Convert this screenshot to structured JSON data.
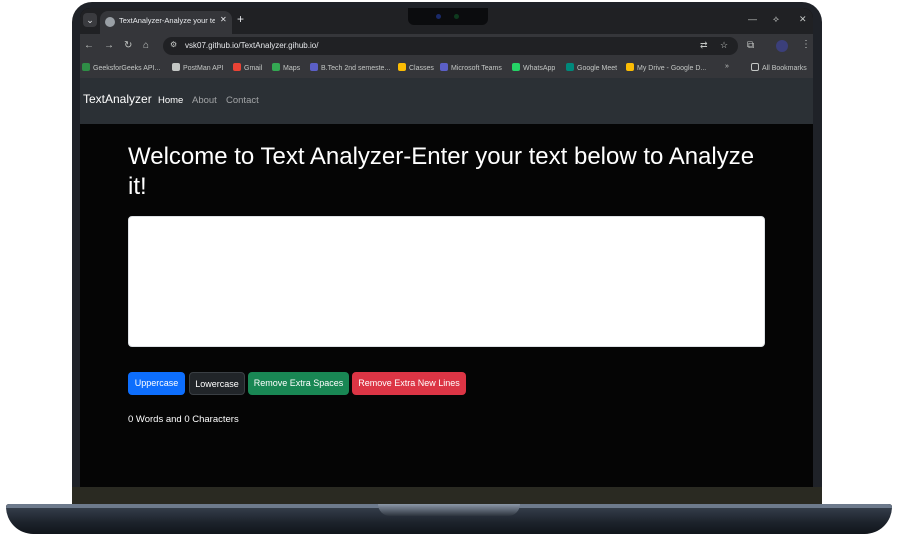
{
  "browser": {
    "tab_title": "TextAnalyzer-Analyze your text",
    "tab_close": "✕",
    "new_tab": "+",
    "url": "vsk07.github.io/TextAnalyzer.gihub.io/",
    "window_controls": {
      "minimize": "—",
      "restore": "⟡",
      "close": "✕"
    },
    "nav": {
      "back": "←",
      "forward": "→",
      "reload": "↻",
      "home": "⌂"
    }
  },
  "bookmarks": [
    {
      "label": "GeeksforGeeks API...",
      "color": "#2f8d46"
    },
    {
      "label": "PostMan API",
      "color": "#c4c7c5"
    },
    {
      "label": "Gmail",
      "color": "#ea4335"
    },
    {
      "label": "Maps",
      "color": "#34a853"
    },
    {
      "label": "B.Tech 2nd semeste...",
      "color": "#5b5fc7"
    },
    {
      "label": "Classes",
      "color": "#fbbc04"
    },
    {
      "label": "Microsoft Teams",
      "color": "#5b5fc7"
    },
    {
      "label": "WhatsApp",
      "color": "#25d366"
    },
    {
      "label": "Google Meet",
      "color": "#00897b"
    },
    {
      "label": "My Drive - Google D...",
      "color": "#fbbc04"
    }
  ],
  "bookmarks_overflow": "»",
  "all_bookmarks": "All Bookmarks",
  "navbar": {
    "brand": "TextAnalyzer",
    "links": [
      "Home",
      "About",
      "Contact"
    ]
  },
  "main": {
    "heading": "Welcome to Text Analyzer-Enter your text below to Analyze it!",
    "textarea_value": "",
    "buttons": {
      "uppercase": "Uppercase",
      "lowercase": "Lowercase",
      "remove_spaces": "Remove Extra Spaces",
      "remove_newlines": "Remove Extra New Lines"
    },
    "summary": "0 Words and 0 Characters"
  },
  "colors": {
    "primary": "#0d6efd",
    "dark": "#212529",
    "success": "#198754",
    "danger": "#dc3545",
    "page_bg": "#050505",
    "navbar_bg": "#2b3035"
  }
}
